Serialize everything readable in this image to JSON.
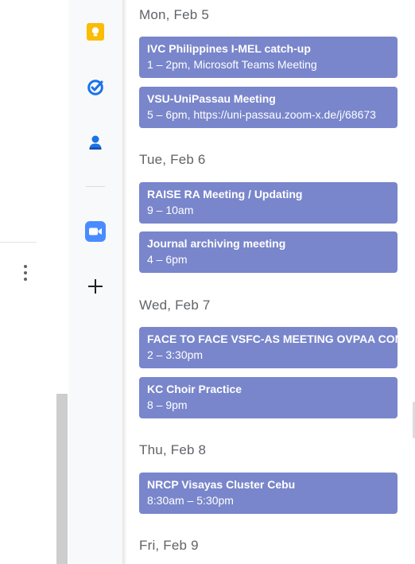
{
  "side_panel": {
    "apps": [
      {
        "name": "Keep",
        "icon": "keep-icon",
        "color": "#fbbc04"
      },
      {
        "name": "Tasks",
        "icon": "tasks-icon",
        "color": "#1a73e8"
      },
      {
        "name": "Contacts",
        "icon": "contacts-icon",
        "color": "#1a73e8"
      },
      {
        "name": "Zoom",
        "icon": "zoom-icon",
        "color": "#4a8cff"
      }
    ],
    "add_label": "+"
  },
  "agenda": {
    "days": [
      {
        "label": "Mon, Feb 5",
        "events": [
          {
            "title": "IVC Philippines I-MEL catch-up",
            "detail": "1 – 2pm, Microsoft Teams Meeting"
          },
          {
            "title": "VSU-UniPassau Meeting",
            "detail": "5 – 6pm, https://uni-passau.zoom-x.de/j/68673"
          }
        ]
      },
      {
        "label": "Tue, Feb 6",
        "events": [
          {
            "title": "RAISE RA Meeting / Updating",
            "detail": "9 – 10am"
          },
          {
            "title": "Journal archiving meeting",
            "detail": "4 – 6pm"
          }
        ]
      },
      {
        "label": "Wed, Feb 7",
        "events": [
          {
            "title": "FACE TO FACE VSFC-AS MEETING OVPAA CON",
            "detail": "2 – 3:30pm"
          },
          {
            "title": "KC Choir Practice",
            "detail": "8 – 9pm"
          }
        ]
      },
      {
        "label": "Thu, Feb 8",
        "events": [
          {
            "title": "NRCP Visayas Cluster Cebu",
            "detail": "8:30am – 5:30pm"
          }
        ]
      },
      {
        "label": "Fri, Feb 9",
        "events": []
      }
    ],
    "event_color": "#7986cb"
  }
}
